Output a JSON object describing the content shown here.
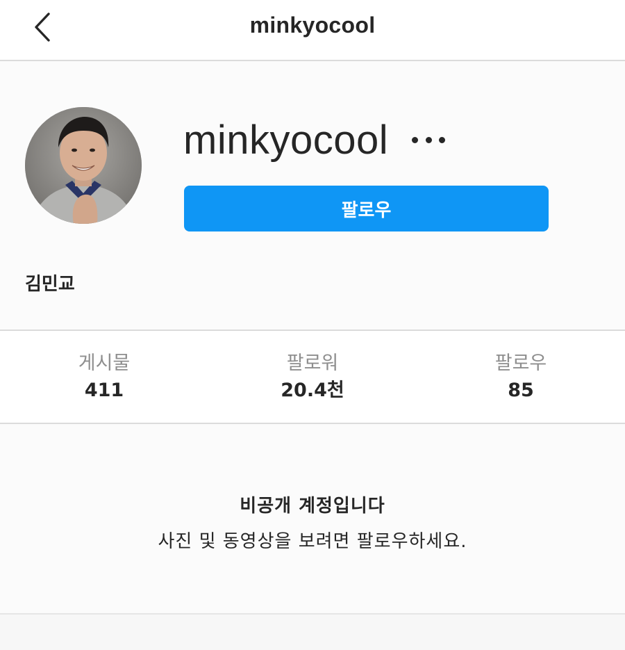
{
  "header": {
    "title": "minkyocool",
    "back_icon": "chevron-left-icon"
  },
  "profile": {
    "username": "minkyocool",
    "more_icon": "more-horizontal-icon",
    "follow_label": "팔로우",
    "full_name": "김민교",
    "avatar": "profile-photo",
    "accent_color": "#0f96f5"
  },
  "stats": [
    {
      "label": "게시물",
      "value": "411"
    },
    {
      "label": "팔로워",
      "value": "20.4천"
    },
    {
      "label": "팔로우",
      "value": "85"
    }
  ],
  "private_notice": {
    "title": "비공개 계정입니다",
    "description": "사진 및 동영상을 보려면 팔로우하세요."
  }
}
